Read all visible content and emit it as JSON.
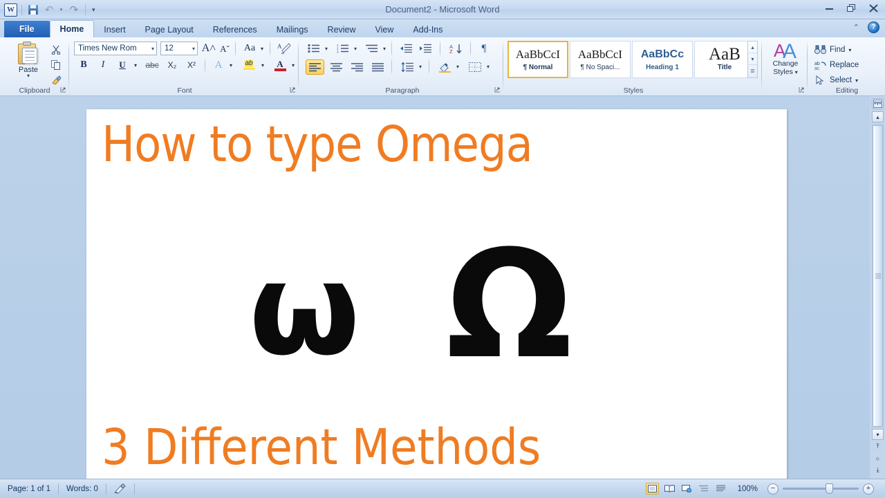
{
  "window": {
    "title": "Document2  -  Microsoft Word",
    "minimize": "–",
    "restore": "❐",
    "close": "✕",
    "collapse_ribbon": "⌃",
    "help": "?"
  },
  "quick_access": {
    "logo": "W",
    "save": "save-icon",
    "undo": "undo-icon",
    "undo_caret": "▾",
    "redo": "redo-icon",
    "customize": "▾"
  },
  "tabs": [
    {
      "label": "File",
      "state": "file"
    },
    {
      "label": "Home",
      "state": "active"
    },
    {
      "label": "Insert",
      "state": "normal"
    },
    {
      "label": "Page Layout",
      "state": "normal"
    },
    {
      "label": "References",
      "state": "normal"
    },
    {
      "label": "Mailings",
      "state": "normal"
    },
    {
      "label": "Review",
      "state": "normal"
    },
    {
      "label": "View",
      "state": "normal"
    },
    {
      "label": "Add-Ins",
      "state": "normal"
    }
  ],
  "ribbon": {
    "clipboard": {
      "group_label": "Clipboard",
      "paste_label": "Paste",
      "paste_caret": "▾",
      "cut": "✂",
      "copy": "⧉",
      "format_painter": "὘c",
      "dialog_launcher": "⤵"
    },
    "font": {
      "group_label": "Font",
      "font_name": "Times New Rom",
      "font_size": "12",
      "caret": "▾",
      "grow_font": "A˄",
      "shrink_font": "Aˇ",
      "change_case": "Aa",
      "clear_formatting": "A⌫",
      "bold": "B",
      "italic": "I",
      "underline": "U",
      "strikethrough": "abc",
      "subscript": "X₂",
      "superscript": "X²",
      "text_effects": "A",
      "highlight": "ab",
      "font_color": "A",
      "dialog_launcher": "⤵"
    },
    "paragraph": {
      "group_label": "Paragraph",
      "bullets": "•–",
      "numbering": "1–",
      "multilevel": "≡",
      "decrease_indent": "⇤",
      "increase_indent": "⇥",
      "sort": "A↓",
      "show_marks": "¶",
      "align_left": "align-left",
      "align_center": "align-center",
      "align_right": "align-right",
      "justify": "justify",
      "line_spacing": "↕",
      "shading": "shading",
      "borders": "borders",
      "dialog_launcher": "⤵"
    },
    "styles": {
      "group_label": "Styles",
      "items": [
        {
          "preview": "AaBbCcI",
          "name": "¶ Normal",
          "kind": "normal",
          "selected": true
        },
        {
          "preview": "AaBbCcI",
          "name": "¶ No Spaci...",
          "kind": "normal",
          "selected": false
        },
        {
          "preview": "AaBbCс",
          "name": "Heading 1",
          "kind": "h1",
          "selected": false
        },
        {
          "preview": "AaB",
          "name": "Title",
          "kind": "title",
          "selected": false
        }
      ],
      "scroll_up": "▴",
      "scroll_down": "▾",
      "more": "≣"
    },
    "change_styles": {
      "label_line1": "Change",
      "label_line2": "Styles",
      "caret": "▾",
      "icon": "AA"
    },
    "editing": {
      "group_label": "Editing",
      "find": "Find",
      "find_caret": "▾",
      "replace": "Replace",
      "select": "Select",
      "select_caret": "▾",
      "find_icon": "binoculars-icon",
      "replace_icon": "replace-icon",
      "select_icon": "cursor-icon"
    }
  },
  "document": {
    "title_text": "How to type Omega",
    "subtitle_text": "3 Different Methods",
    "omega_lower": "ω",
    "omega_upper": "Ω",
    "text_color": "#F07C22"
  },
  "right_rail": {
    "ruler_toggle": "ruler-icon",
    "scroll_up": "▴",
    "scroll_down": "▾",
    "previous_page": "⤒",
    "select_browse_object": "○",
    "next_page": "⤓"
  },
  "status_bar": {
    "page": "Page: 1 of 1",
    "words": "Words: 0",
    "proofing_icon": "proofing-icon",
    "views": [
      {
        "name": "print-layout",
        "glyph": "▤",
        "selected": true
      },
      {
        "name": "full-screen-reading",
        "glyph": "ὖe",
        "selected": false
      },
      {
        "name": "web-layout",
        "glyph": "⧉",
        "selected": false
      },
      {
        "name": "outline",
        "glyph": "≡",
        "selected": false
      },
      {
        "name": "draft",
        "glyph": "☷",
        "selected": false
      }
    ],
    "zoom_level": "100%",
    "zoom_out": "−",
    "zoom_in": "+"
  }
}
